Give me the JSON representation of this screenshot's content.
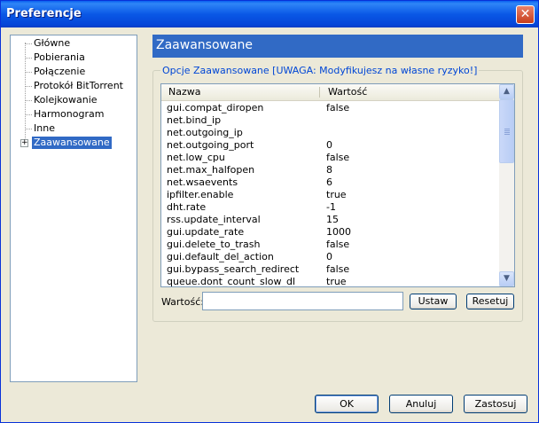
{
  "window": {
    "title": "Preferencje",
    "close_label": "✕"
  },
  "tree": {
    "items": [
      {
        "label": "Główne"
      },
      {
        "label": "Pobierania"
      },
      {
        "label": "Połączenie"
      },
      {
        "label": "Protokół BitTorrent"
      },
      {
        "label": "Kolejkowanie"
      },
      {
        "label": "Harmonogram"
      },
      {
        "label": "Inne"
      },
      {
        "label": "Zaawansowane",
        "selected": true
      }
    ],
    "expander_label": "+"
  },
  "panel": {
    "title": "Zaawansowane",
    "group_label": "Opcje Zaawansowane [UWAGA: Modyfikujesz na własne ryzyko!]"
  },
  "table": {
    "columns": [
      "Nazwa",
      "Wartość"
    ],
    "rows": [
      {
        "name": "gui.compat_diropen",
        "value": "false"
      },
      {
        "name": "net.bind_ip",
        "value": ""
      },
      {
        "name": "net.outgoing_ip",
        "value": ""
      },
      {
        "name": "net.outgoing_port",
        "value": "0"
      },
      {
        "name": "net.low_cpu",
        "value": "false"
      },
      {
        "name": "net.max_halfopen",
        "value": "8"
      },
      {
        "name": "net.wsaevents",
        "value": "6"
      },
      {
        "name": "ipfilter.enable",
        "value": "true"
      },
      {
        "name": "dht.rate",
        "value": "-1"
      },
      {
        "name": "rss.update_interval",
        "value": "15"
      },
      {
        "name": "gui.update_rate",
        "value": "1000"
      },
      {
        "name": "gui.delete_to_trash",
        "value": "false"
      },
      {
        "name": "gui.default_del_action",
        "value": "0"
      },
      {
        "name": "gui.bypass_search_redirect",
        "value": "false"
      },
      {
        "name": "queue.dont_count_slow_dl",
        "value": "true"
      }
    ]
  },
  "editor": {
    "label": "Wartość:",
    "value": "",
    "set_button": "Ustaw",
    "reset_button": "Resetuj"
  },
  "footer": {
    "ok": "OK",
    "cancel": "Anuluj",
    "apply": "Zastosuj"
  },
  "icons": {
    "scroll_up": "▲",
    "scroll_down": "▼"
  },
  "colors": {
    "titlebar": "#0a58e6",
    "selection": "#316ac5",
    "legend_text": "#0046d5"
  }
}
